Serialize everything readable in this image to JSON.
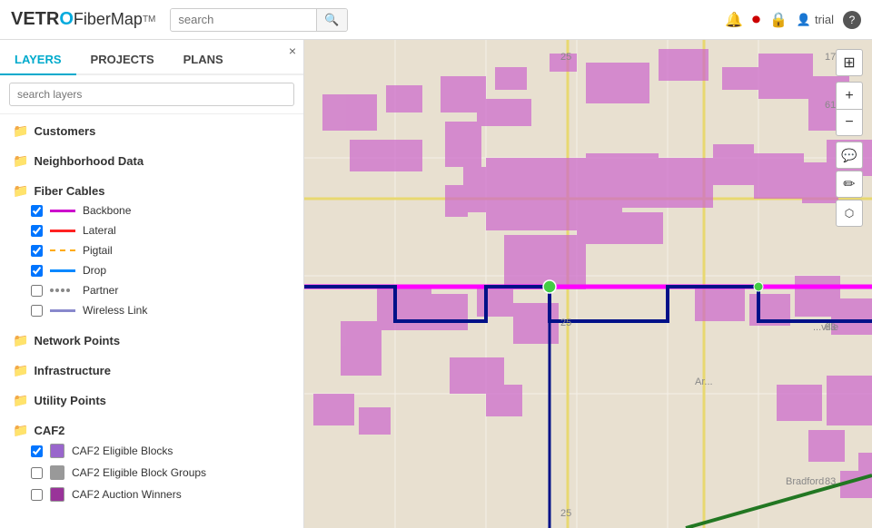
{
  "header": {
    "logo": {
      "vetro": "VETR",
      "circle": "O",
      "fibermap": "FiberMap",
      "tm": "TM"
    },
    "search": {
      "placeholder": "search",
      "button_icon": "🔍"
    },
    "icons": {
      "bell": "🔔",
      "toggle": "🔘",
      "lock": "🔒",
      "user": "👤",
      "trial": "trial",
      "help": "?"
    }
  },
  "sidebar": {
    "close_label": "×",
    "tabs": [
      {
        "id": "layers",
        "label": "LAYERS",
        "active": true
      },
      {
        "id": "projects",
        "label": "PROJECTS",
        "active": false
      },
      {
        "id": "plans",
        "label": "PLANS",
        "active": false
      }
    ],
    "search_layers_placeholder": "search layers",
    "layer_groups": [
      {
        "id": "customers",
        "label": "Customers",
        "has_children": false
      },
      {
        "id": "neighborhood-data",
        "label": "Neighborhood Data",
        "has_children": false
      },
      {
        "id": "fiber-cables",
        "label": "Fiber Cables",
        "has_children": true,
        "children": [
          {
            "id": "backbone",
            "label": "Backbone",
            "checked": true,
            "line_color": "#cc00cc",
            "line_type": "solid"
          },
          {
            "id": "lateral",
            "label": "Lateral",
            "checked": true,
            "line_color": "#ff2222",
            "line_type": "solid"
          },
          {
            "id": "pigtail",
            "label": "Pigtail",
            "checked": true,
            "line_color": "#ffaa00",
            "line_type": "dashed"
          },
          {
            "id": "drop",
            "label": "Drop",
            "checked": true,
            "line_color": "#0088ff",
            "line_type": "solid"
          },
          {
            "id": "partner",
            "label": "Partner",
            "checked": false,
            "line_color": "#666666",
            "line_type": "dotted"
          },
          {
            "id": "wireless-link",
            "label": "Wireless Link",
            "checked": false,
            "line_color": "#8888cc",
            "line_type": "solid"
          }
        ]
      },
      {
        "id": "network-points",
        "label": "Network Points",
        "has_children": false
      },
      {
        "id": "infrastructure",
        "label": "Infrastructure",
        "has_children": false
      },
      {
        "id": "utility-points",
        "label": "Utility Points",
        "has_children": false
      },
      {
        "id": "caf2",
        "label": "CAF2",
        "has_children": true,
        "children": [
          {
            "id": "caf2-eligible-blocks",
            "label": "CAF2 Eligible Blocks",
            "checked": true,
            "swatch_color": "#9966cc"
          },
          {
            "id": "caf2-eligible-block-groups",
            "label": "CAF2 Eligible Block Groups",
            "checked": false,
            "swatch_color": "#999999"
          },
          {
            "id": "caf2-auction-winners",
            "label": "CAF2 Auction Winners",
            "checked": false,
            "swatch_color": "#993399"
          }
        ]
      }
    ]
  },
  "map_controls": {
    "layers_icon": "⊞",
    "zoom_in": "+",
    "zoom_out": "−",
    "comment_icon": "💬",
    "edit_icon": "✏",
    "select_icon": "⬡"
  }
}
